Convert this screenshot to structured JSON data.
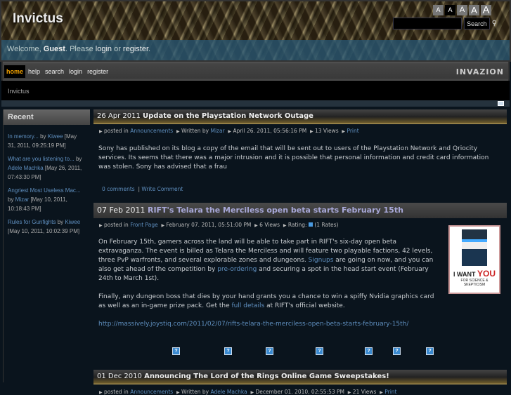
{
  "header": {
    "site_title": "Invictus",
    "font_sizes": [
      "A",
      "A",
      "A",
      "A",
      "A"
    ],
    "search_button": "Search",
    "search_value": ""
  },
  "welcome": {
    "prefix": "Welcome, ",
    "user": "Guest",
    "mid": ". Please ",
    "login": "login",
    "or": " or ",
    "register": "register",
    "end": "."
  },
  "nav": {
    "items": [
      "home",
      "help",
      "search",
      "login",
      "register"
    ],
    "logo": "INVAZION"
  },
  "breadcrumb": "Invictus",
  "sidebar": {
    "title": "Recent",
    "items": [
      {
        "title": "In memory...",
        "by": " by ",
        "author": "Kiwee",
        "date": " [May 31, 2011, 09:25:19 PM]"
      },
      {
        "title": "What are you listening to...",
        "by": " by ",
        "author": "Adele Machka",
        "date": " [May 26, 2011, 07:43:30 PM]"
      },
      {
        "title": "Angriest Most Useless Mac...",
        "by": " by ",
        "author": "Mizar",
        "date": " [May 10, 2011, 10:18:43 PM]"
      },
      {
        "title": "Rules for Gunfights",
        "by": " by ",
        "author": "Kiwee",
        "date": " [May 10, 2011, 10:02:39 PM]"
      }
    ]
  },
  "posts": [
    {
      "date": "26 Apr 2011",
      "title": "Update on the Playstation Network Outage",
      "meta": {
        "posted": "posted in ",
        "category": "Announcements",
        "written": "Written by ",
        "author": "Mizar",
        "datetime": "April 26. 2011, 05:56:16 PM",
        "views": "13 Views",
        "print": "Print"
      },
      "body": "Sony has published on its blog a copy of the email that will be sent out to users of the Playstation Network and Qriocity services. Its seems that there was a major intrusion and it is possible that personal information and credit card information was stolen.  Sony has advised that a frau",
      "comments": "0 comments",
      "write": "Write Comment"
    },
    {
      "date": "07 Feb 2011",
      "title": "RIFT's Telara the Merciless open beta starts February 15th",
      "meta": {
        "posted": "posted in ",
        "category": "Front Page",
        "datetime": "February 07. 2011, 05:51:00 PM",
        "views": "6 Views",
        "rating": "Rating:",
        "rates": "(1 Rates)"
      },
      "p1a": "On February 15th, gamers across the land will be able to take part in RIFT's six-day open beta extravaganza. The event is billed as Telara the Merciless and will feature two playable factions, 42 levels, three PvP warfronts, and several explorable zones and dungeons. ",
      "signups": "Signups",
      "p1b": " are going on now, and you can also get ahead of the competition by ",
      "preorder": "pre-ordering",
      "p1c": " and securing a spot in the head start event (February 24th to March 1st).",
      "p2a": "Finally, any dungeon boss that dies by your hand grants you a chance to win a spiffy Nvidia graphics card as well as an in-game prize pack. Get the ",
      "details": "full details",
      "p2b": " at RIFT's  official website.",
      "url": "http://massively.joystiq.com/2011/02/07/rifts-telara-the-merciless-open-beta-starts-february-15th/",
      "poster": {
        "line1": "I WANT",
        "you": "YOU",
        "line2": "FOR SCIENCE & SKEPTICISM"
      }
    },
    {
      "date": "01 Dec 2010",
      "title": "Announcing The Lord of the Rings Online Game Sweepstakes!",
      "meta": {
        "posted": "posted in ",
        "category": "Announcements",
        "written": "Written by ",
        "author": "Adele Machka",
        "datetime": "December 01. 2010, 02:55:53 PM",
        "views": "21 Views",
        "print": "Print"
      }
    }
  ],
  "share_icon": "?"
}
